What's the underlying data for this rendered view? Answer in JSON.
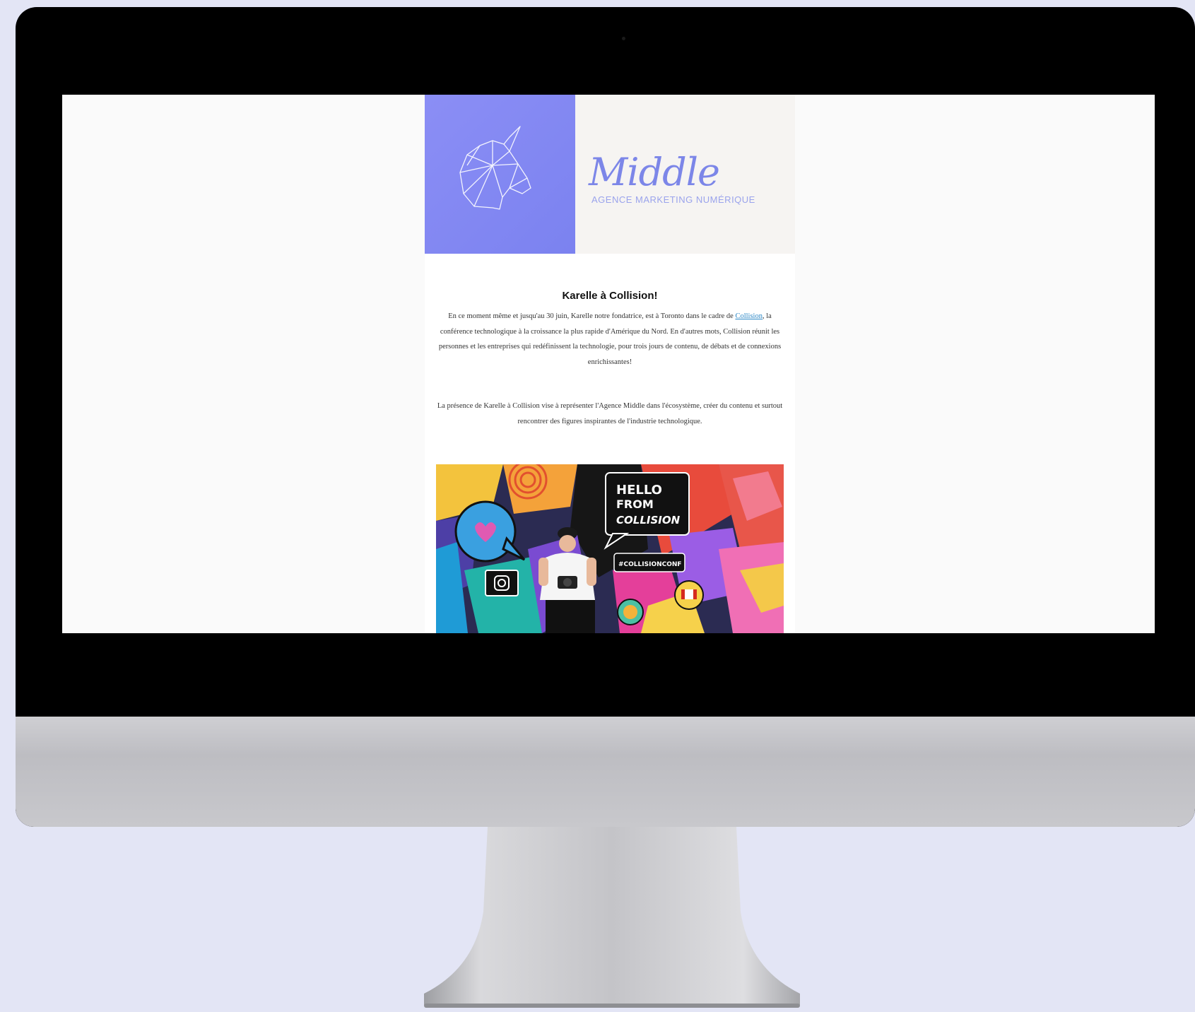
{
  "email": {
    "brand": {
      "name": "Middle",
      "tagline": "AGENCE MARKETING NUMÉRIQUE"
    },
    "article": {
      "title": "Karelle à Collision!",
      "p1_before": "En ce moment même et jusqu'au 30 juin, Karelle notre fondatrice, est à Toronto dans le cadre de ",
      "p1_link": "Collision",
      "p1_after": ", la conférence technologique à la croissance la plus rapide d'Amérique du Nord. En d'autres mots, Collision réunit les personnes et les entreprises qui redéfinissent la technologie, pour trois jours de contenu, de débats et de connexions enrichissantes!",
      "p2": "La présence de Karelle à Collision vise à représenter l'Agence Middle dans l'écosystème, créer du contenu et surtout rencontrer des figures inspirantes de l'industrie technologique."
    },
    "photo": {
      "sign_line1": "HELLO",
      "sign_line2": "FROM",
      "sign_line3": "COLLISION",
      "hashtag": "#COLLISIONCONF"
    }
  },
  "colors": {
    "background": "#e3e5f5",
    "hero_purple": "#8b8ef5",
    "brand_text": "#7c86e8",
    "link": "#2a87c6"
  }
}
